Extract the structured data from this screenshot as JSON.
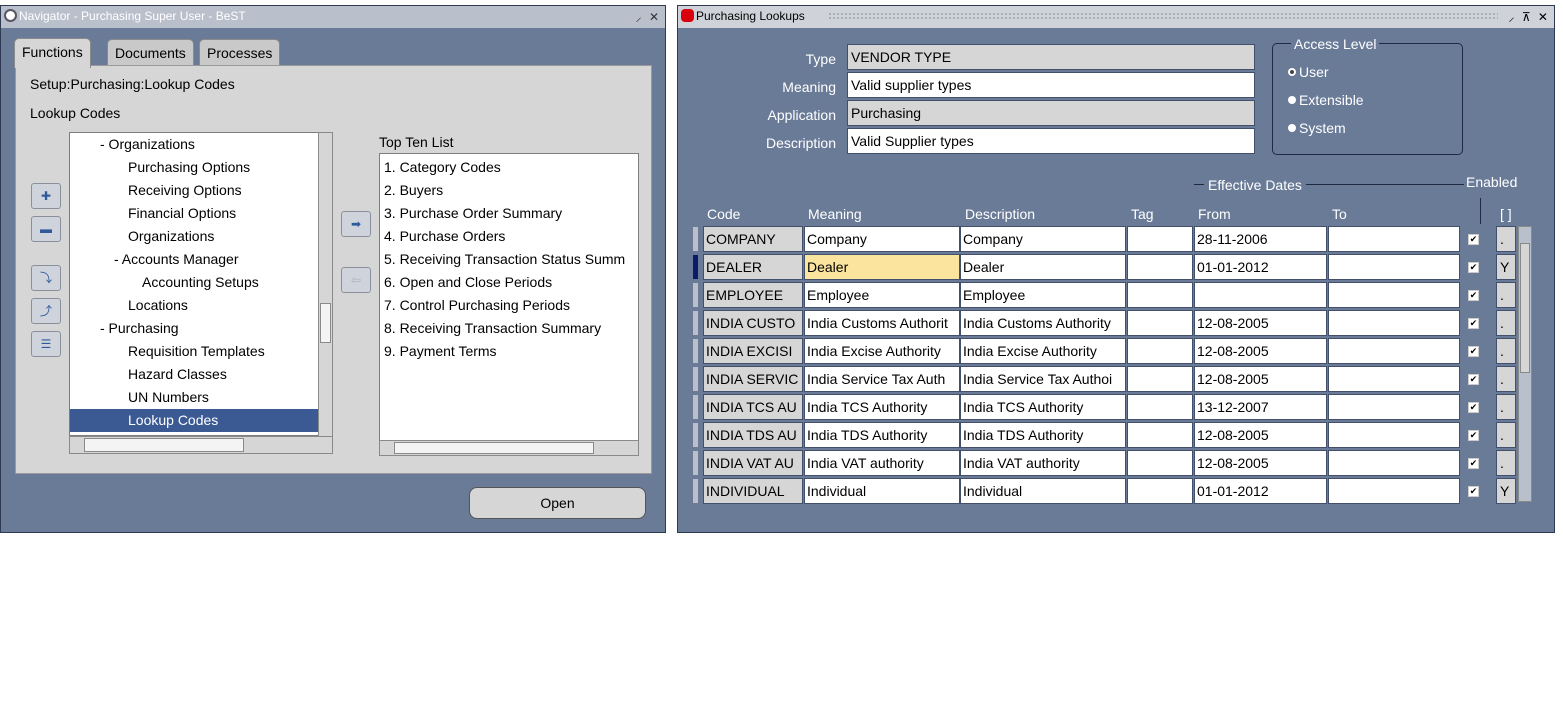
{
  "navigator": {
    "title": "Navigator - Purchasing Super User - BeST",
    "title_controls": "⸝ ✕",
    "tabs": [
      "Functions",
      "Documents",
      "Processes"
    ],
    "path": "Setup:Purchasing:Lookup Codes",
    "current": "Lookup Codes",
    "tree": [
      {
        "label": "- Organizations",
        "indent": 1
      },
      {
        "label": "Purchasing Options",
        "indent": 3
      },
      {
        "label": "Receiving Options",
        "indent": 3
      },
      {
        "label": "Financial Options",
        "indent": 3
      },
      {
        "label": "Organizations",
        "indent": 3
      },
      {
        "label": "- Accounts Manager",
        "indent": 2
      },
      {
        "label": "Accounting Setups",
        "indent": 4
      },
      {
        "label": "Locations",
        "indent": 3
      },
      {
        "label": "- Purchasing",
        "indent": 1
      },
      {
        "label": "Requisition Templates",
        "indent": 3
      },
      {
        "label": "Hazard Classes",
        "indent": 3
      },
      {
        "label": "UN Numbers",
        "indent": 3
      },
      {
        "label": "Lookup Codes",
        "indent": 3,
        "selected": true
      }
    ],
    "top_ten_label": "Top Ten List",
    "top_ten": [
      "1. Category Codes",
      "2. Buyers",
      "3. Purchase Order Summary",
      "4. Purchase Orders",
      "5. Receiving Transaction Status Summ",
      "6. Open and Close Periods",
      "7. Control Purchasing Periods",
      "8. Receiving Transaction Summary",
      "9. Payment Terms"
    ],
    "open_button": "Open"
  },
  "lookups": {
    "title": "Purchasing Lookups",
    "title_controls": "⸝ ⊼ ✕",
    "type_label": "Type",
    "type_value": "VENDOR TYPE",
    "meaning_label": "Meaning",
    "meaning_value": "Valid supplier types",
    "application_label": "Application",
    "application_value": "Purchasing",
    "description_label": "Description",
    "description_value": "Valid Supplier types",
    "access_level": {
      "title": "Access Level",
      "options": [
        "User",
        "Extensible",
        "System"
      ],
      "selected": "User"
    },
    "effective_dates_label": "Effective Dates",
    "enabled_label": "Enabled",
    "columns": {
      "code": "Code",
      "meaning": "Meaning",
      "description": "Description",
      "tag": "Tag",
      "from": "From",
      "to": "To",
      "dff": "[ ]"
    },
    "rows": [
      {
        "code": "COMPANY",
        "meaning": "Company",
        "description": "Company",
        "tag": "",
        "from": "28-11-2006",
        "to": "",
        "enabled": true,
        "dff": "."
      },
      {
        "code": "DEALER",
        "meaning": "Dealer",
        "description": "Dealer",
        "tag": "",
        "from": "01-01-2012",
        "to": "",
        "enabled": true,
        "dff": "Y"
      },
      {
        "code": "EMPLOYEE",
        "meaning": "Employee",
        "description": "Employee",
        "tag": "",
        "from": "",
        "to": "",
        "enabled": true,
        "dff": "."
      },
      {
        "code": "INDIA CUSTO",
        "meaning": "India Customs Authorit",
        "description": "India Customs Authority",
        "tag": "",
        "from": "12-08-2005",
        "to": "",
        "enabled": true,
        "dff": "."
      },
      {
        "code": "INDIA EXCISI",
        "meaning": "India Excise Authority",
        "description": "India Excise Authority",
        "tag": "",
        "from": "12-08-2005",
        "to": "",
        "enabled": true,
        "dff": "."
      },
      {
        "code": "INDIA SERVIC",
        "meaning": "India Service Tax Auth",
        "description": "India Service Tax Authoi",
        "tag": "",
        "from": "12-08-2005",
        "to": "",
        "enabled": true,
        "dff": "."
      },
      {
        "code": "INDIA TCS AU",
        "meaning": "India TCS Authority",
        "description": "India TCS Authority",
        "tag": "",
        "from": "13-12-2007",
        "to": "",
        "enabled": true,
        "dff": "."
      },
      {
        "code": "INDIA TDS AU",
        "meaning": "India TDS Authority",
        "description": "India TDS Authority",
        "tag": "",
        "from": "12-08-2005",
        "to": "",
        "enabled": true,
        "dff": "."
      },
      {
        "code": "INDIA VAT AU",
        "meaning": "India VAT authority",
        "description": "India VAT authority",
        "tag": "",
        "from": "12-08-2005",
        "to": "",
        "enabled": true,
        "dff": "."
      },
      {
        "code": "INDIVIDUAL",
        "meaning": "Individual",
        "description": "Individual",
        "tag": "",
        "from": "01-01-2012",
        "to": "",
        "enabled": true,
        "dff": "Y"
      }
    ],
    "current_row": 1
  },
  "colors": {
    "window_bg": "#6a7b98",
    "panel_bg": "#d6d6d6",
    "selection": "#3b5a93",
    "highlight": "#fbe59e"
  }
}
